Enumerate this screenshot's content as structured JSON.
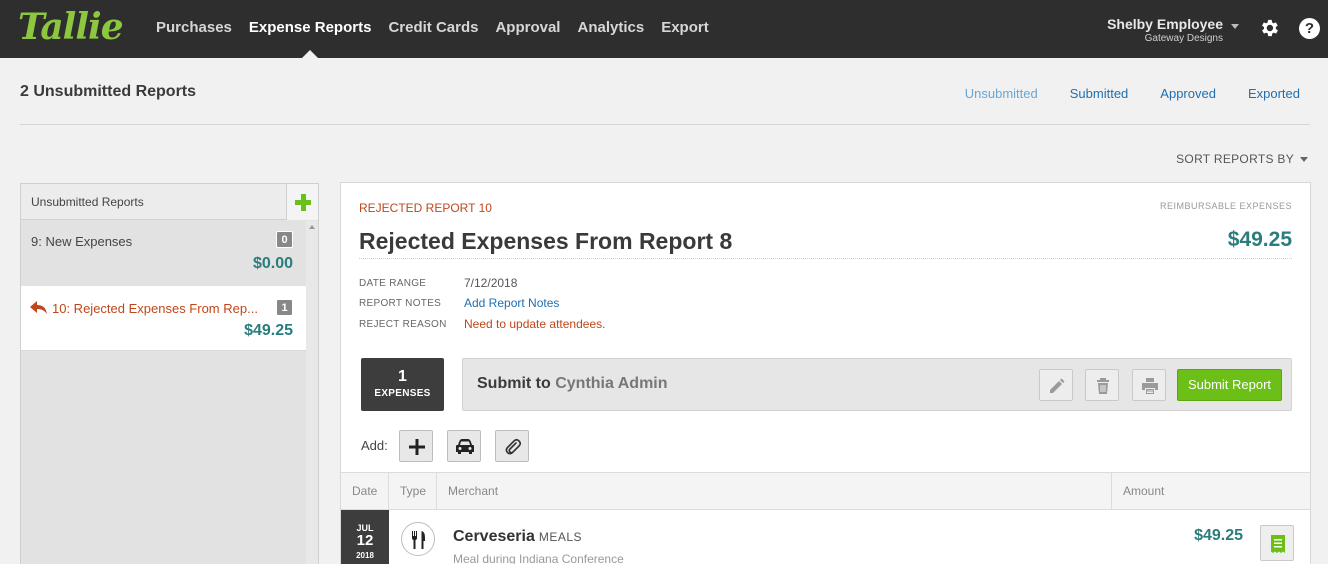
{
  "app": {
    "logo": "Tallie",
    "nav": [
      "Purchases",
      "Expense Reports",
      "Credit Cards",
      "Approval",
      "Analytics",
      "Export"
    ],
    "active_nav_index": 1,
    "user": {
      "name": "Shelby Employee",
      "org": "Gateway Designs"
    },
    "help_label": "?"
  },
  "page": {
    "title": "2 Unsubmitted Reports",
    "status_tabs": [
      "Unsubmitted",
      "Submitted",
      "Approved",
      "Exported"
    ],
    "current_status_index": 0,
    "sort_label": "SORT REPORTS BY"
  },
  "sidebar": {
    "title": "Unsubmitted Reports",
    "reports": [
      {
        "name": "9: New Expenses",
        "count": "0",
        "amount": "$0.00"
      },
      {
        "name": "10: Rejected Expenses From Rep...",
        "count": "1",
        "amount": "$49.25"
      }
    ]
  },
  "report": {
    "label": "REJECTED REPORT 10",
    "reimbursable_label": "REIMBURSABLE EXPENSES",
    "title": "Rejected Expenses From Report 8",
    "total": "$49.25",
    "meta": {
      "date_range_label": "DATE RANGE",
      "date_range": "7/12/2018",
      "notes_label": "REPORT NOTES",
      "notes_link": "Add Report Notes",
      "reject_label": "REJECT REASON",
      "reject_reason": "Need to update attendees."
    },
    "expense_count": "1",
    "expense_count_label": "EXPENSES",
    "submit_prefix": "Submit to",
    "submit_to": "Cynthia Admin",
    "submit_button": "Submit Report",
    "add_label": "Add:"
  },
  "table": {
    "headers": {
      "date": "Date",
      "type": "Type",
      "merchant": "Merchant",
      "amount": "Amount"
    },
    "rows": [
      {
        "month": "JUL",
        "day": "12",
        "year": "2018",
        "merchant": "Cerveseria",
        "category": "MEALS",
        "description": "Meal during Indiana Conference",
        "amount": "$49.25",
        "type_icon": "fork-knife-icon"
      }
    ]
  },
  "colors": {
    "brand_green": "#8dc63f",
    "submit_green": "#6bbf17",
    "money_teal": "#2b7c7c",
    "rejected_orange": "#c0471b",
    "link_blue": "#1f6fb2"
  }
}
